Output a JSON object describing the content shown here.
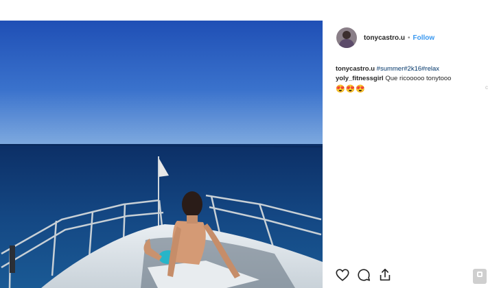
{
  "post": {
    "author": {
      "username": "tonycastro.u",
      "separator": "•",
      "follow_label": "Follow"
    },
    "caption": {
      "username": "tonycastro.u",
      "text": "#summer#2k16#relax"
    },
    "comments": [
      {
        "username": "yoly_fitnessgirl",
        "text": "Que ricooooo tonytooo",
        "emojis": "😍😍😍"
      }
    ],
    "colors": {
      "follow": "#3897f0",
      "hashtag": "#003569",
      "sky_top": "#1f4fb5",
      "sea": "#123a6e"
    },
    "icons": [
      "heart-icon",
      "comment-icon",
      "share-icon"
    ]
  }
}
